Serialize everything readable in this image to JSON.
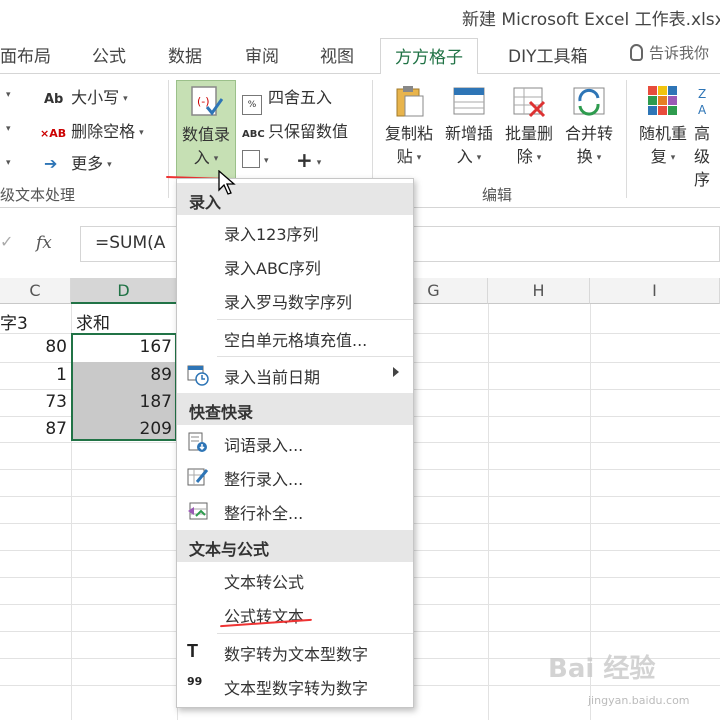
{
  "window": {
    "title": "新建 Microsoft Excel 工作表.xlsx"
  },
  "tabs": [
    "面布局",
    "公式",
    "数据",
    "审阅",
    "视图",
    "方方格子",
    "DIY工具箱"
  ],
  "tellme": "告诉我你",
  "ribbon": {
    "left_group": {
      "case": "大小写",
      "case_icon": "Ab",
      "delete_space": "删除空格",
      "delete_icon": "×AB",
      "more": "更多",
      "label": "级文本处理"
    },
    "number_entry": {
      "line1": "数值录",
      "line2": "入"
    },
    "round": "四舍五入",
    "keep_values": "只保留数值",
    "keep_icon": "ABC",
    "plus": "+",
    "edit_buttons": [
      {
        "line1": "复制粘",
        "line2": "贴"
      },
      {
        "line1": "新增插",
        "line2": "入"
      },
      {
        "line1": "批量删",
        "line2": "除"
      },
      {
        "line1": "合并转",
        "line2": "换"
      }
    ],
    "edit_label": "编辑",
    "extra_buttons": [
      {
        "line1": "随机重",
        "line2": "复"
      },
      {
        "line1": "高级",
        "line2": "序"
      }
    ]
  },
  "formula_bar": {
    "fx": "fx",
    "formula": "=SUM(A"
  },
  "grid": {
    "columns": [
      "C",
      "D",
      "E",
      "F",
      "G",
      "H",
      "I"
    ],
    "header_row": {
      "c": "字3",
      "d": "求和"
    },
    "rows": [
      {
        "c": "80",
        "d": "167"
      },
      {
        "c": "1",
        "d": "89"
      },
      {
        "c": "73",
        "d": "187"
      },
      {
        "c": "87",
        "d": "209"
      }
    ]
  },
  "menu": {
    "sections": [
      {
        "title": "录入",
        "items": [
          "录入123序列",
          "录入ABC序列",
          "录入罗马数字序列",
          "空白单元格填充值...",
          "录入当前日期"
        ]
      },
      {
        "title": "快查快录",
        "items": [
          "词语录入...",
          "整行录入...",
          "整行补全..."
        ]
      },
      {
        "title": "文本与公式",
        "items": [
          "文本转公式",
          "公式转文本",
          "数字转为文本型数字",
          "文本型数字转为数字"
        ]
      }
    ],
    "icon_T": "T",
    "icon_99": "99"
  },
  "watermark": {
    "main": "Bai 经验",
    "sub": "jingyan.baidu.com"
  }
}
